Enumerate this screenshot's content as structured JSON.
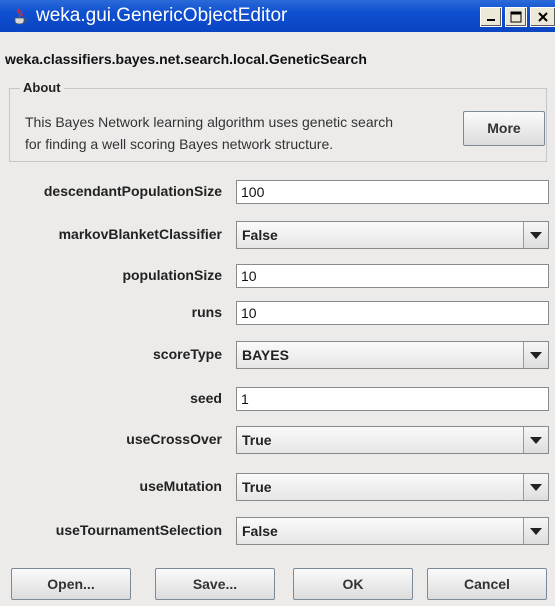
{
  "window": {
    "title": "weka.gui.GenericObjectEditor"
  },
  "class_name": "weka.classifiers.bayes.net.search.local.GeneticSearch",
  "about": {
    "legend": "About",
    "text_line1": "This Bayes Network learning algorithm uses genetic search",
    "text_line2": "for finding a well scoring Bayes network structure.",
    "more_label": "More"
  },
  "fields": [
    {
      "label": "descendantPopulationSize",
      "value": "100"
    },
    {
      "label": "markovBlanketClassifier",
      "value": "False"
    },
    {
      "label": "populationSize",
      "value": "10"
    },
    {
      "label": "runs",
      "value": "10"
    },
    {
      "label": "scoreType",
      "value": "BAYES"
    },
    {
      "label": "seed",
      "value": "1"
    },
    {
      "label": "useCrossOver",
      "value": "True"
    },
    {
      "label": "useMutation",
      "value": "True"
    },
    {
      "label": "useTournamentSelection",
      "value": "False"
    }
  ],
  "buttons": {
    "open": "Open...",
    "save": "Save...",
    "ok": "OK",
    "cancel": "Cancel"
  }
}
